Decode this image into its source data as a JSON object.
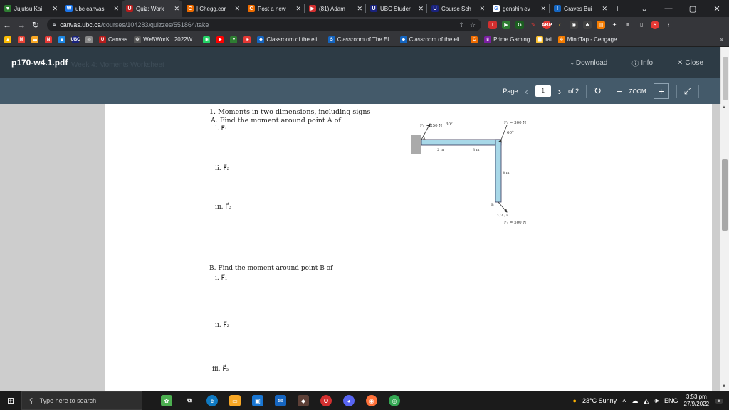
{
  "browser": {
    "tabs": [
      {
        "title": "Jujutsu Kai",
        "fav_color": "#2e7d32",
        "fav_glyph": "▼"
      },
      {
        "title": "ubc canvas",
        "fav_color": "#1a73e8",
        "fav_glyph": "W"
      },
      {
        "title": "Quiz: Work",
        "fav_color": "#b71c1c",
        "fav_glyph": "U",
        "active": true
      },
      {
        "title": "| Chegg.cor",
        "fav_color": "#ef6c00",
        "fav_glyph": "C"
      },
      {
        "title": "Post a new",
        "fav_color": "#ef6c00",
        "fav_glyph": "C"
      },
      {
        "title": "(81) Adam",
        "fav_color": "#d32f2f",
        "fav_glyph": "▶"
      },
      {
        "title": "UBC Studer",
        "fav_color": "#1a237e",
        "fav_glyph": "U"
      },
      {
        "title": "Course Sch",
        "fav_color": "#1a237e",
        "fav_glyph": "U"
      },
      {
        "title": "genshin ev",
        "fav_color": "#ffffff",
        "fav_glyph": "G"
      },
      {
        "title": "Graves Bui",
        "fav_color": "#1565c0",
        "fav_glyph": "!"
      }
    ],
    "new_tab": "+",
    "window_controls": {
      "chevron": "⌄",
      "minimize": "—",
      "restore": "▢",
      "close": "✕"
    },
    "url_host": "canvas.ubc.ca",
    "url_path": "/courses/104283/quizzes/551864/take",
    "bookmarks": [
      {
        "label": "",
        "color": "#fbbc05",
        "glyph": "▲"
      },
      {
        "label": "",
        "color": "#ea4335",
        "glyph": "M"
      },
      {
        "label": "",
        "color": "#f9a825",
        "glyph": "▬"
      },
      {
        "label": "",
        "color": "#e53935",
        "glyph": "N"
      },
      {
        "label": "",
        "color": "#1e88e5",
        "glyph": "▲"
      },
      {
        "label": "",
        "color": "#1a237e",
        "glyph": "UBC"
      },
      {
        "label": "",
        "color": "#888888",
        "glyph": "◎"
      },
      {
        "label": "Canvas",
        "color": "#b71c1c",
        "glyph": "U"
      },
      {
        "label": "WeBWorK : 2022W...",
        "color": "#555555",
        "glyph": "❂"
      },
      {
        "label": "",
        "color": "#25d366",
        "glyph": "◉"
      },
      {
        "label": "",
        "color": "#ff0000",
        "glyph": "▶"
      },
      {
        "label": "",
        "color": "#2e7d32",
        "glyph": "▼"
      },
      {
        "label": "",
        "color": "#e53935",
        "glyph": "◈"
      },
      {
        "label": "Classroom of the eli...",
        "color": "#1565c0",
        "glyph": "◆"
      },
      {
        "label": "Classroom of The El...",
        "color": "#1565c0",
        "glyph": "S"
      },
      {
        "label": "Classroom of the eli...",
        "color": "#1565c0",
        "glyph": "◆"
      },
      {
        "label": "",
        "color": "#ef6c00",
        "glyph": "C"
      },
      {
        "label": "Prime Gaming",
        "color": "#7b1fa2",
        "glyph": "♛"
      },
      {
        "label": "tai",
        "color": "#fbc02d",
        "glyph": "▇"
      },
      {
        "label": "MindTap - Cengage...",
        "color": "#f57c00",
        "glyph": "✲"
      }
    ],
    "more_bookmarks": "»"
  },
  "viewer": {
    "file_title": "p170-w4.1.pdf",
    "background_text": "Week  4:  Moments   Worksheet",
    "download_label": "Download",
    "info_label": "Info",
    "close_label": "Close",
    "page_label": "Page",
    "page_current": "1",
    "page_total": "of 2",
    "zoom_label": "ZOOM"
  },
  "pdf": {
    "q1_title": "1. Moments in two dimensions, including signs",
    "partA": "A.  Find the moment around point A of",
    "partA_items": [
      "i.  F⃗₁",
      "ii.  F⃗₂",
      "iii.  F⃗₃"
    ],
    "partB": "B.  Find the moment around point B of",
    "partB_items": [
      "i.  F⃗₁",
      "ii.  F⃗₂",
      "iii.  F⃗₃"
    ],
    "figure": {
      "f1_label": "F₁ = 250 N",
      "f1_angle": "30°",
      "f2_label": "F₂ = 300 N",
      "f2_angle": "60°",
      "f3_label": "F₃ = 500 N",
      "dim1": "2 m",
      "dim2": "3 m",
      "dim3": "4 m",
      "pointA": "A",
      "pointB": "B",
      "f3_dims": "3 / 4 / 5"
    }
  },
  "taskbar": {
    "search_placeholder": "Type here to search",
    "weather": "23°C  Sunny",
    "language": "ENG",
    "time": "3:53 pm",
    "date": "27/9/2022",
    "notification_count": "8"
  }
}
